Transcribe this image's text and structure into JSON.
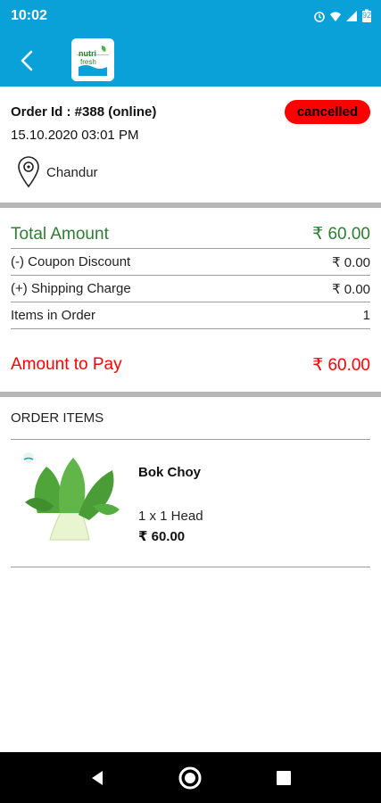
{
  "status_bar": {
    "time": "10:02",
    "battery": "92"
  },
  "app_bar": {
    "logo_text_line1": "nutri",
    "logo_text_line2": "fresh"
  },
  "order": {
    "id_text": "Order Id : #388 (online)",
    "datetime": "15.10.2020 03:01 PM",
    "status": "cancelled",
    "location": "Chandur"
  },
  "totals": {
    "total_amount_label": "Total Amount",
    "total_amount_value": "₹ 60.00",
    "coupon_label": "(-) Coupon Discount",
    "coupon_value": "₹ 0.00",
    "shipping_label": "(+) Shipping Charge",
    "shipping_value": "₹ 0.00",
    "items_label": "Items in Order",
    "items_value": "1",
    "pay_label": "Amount to Pay",
    "pay_value": "₹ 60.00"
  },
  "order_items": {
    "title": "ORDER ITEMS",
    "items": [
      {
        "name": "Bok Choy",
        "qty": "1 x 1 Head",
        "price": "₹ 60.00"
      }
    ]
  },
  "colors": {
    "brand": "#0aa1d8",
    "positive": "#2e7d32",
    "alert": "#ff0000"
  },
  "icons": [
    "back-arrow-icon",
    "location-pin-icon",
    "nav-back-icon",
    "nav-home-icon",
    "nav-recents-icon",
    "alarm-icon",
    "wifi-icon",
    "signal-icon",
    "battery-icon"
  ]
}
